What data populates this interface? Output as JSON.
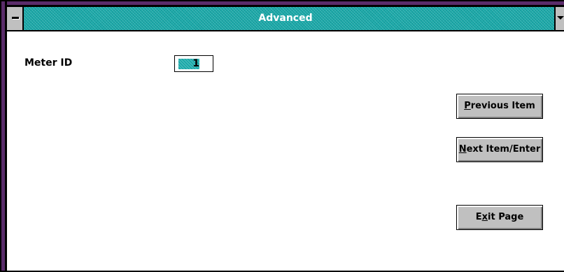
{
  "window": {
    "title": "Advanced"
  },
  "colors": {
    "titlebar": "#19a8a8",
    "frame": "#5a2c6a",
    "button_face": "#c0c0c0"
  },
  "form": {
    "meter_id_label": "Meter ID",
    "meter_id_value": "1"
  },
  "buttons": {
    "previous": {
      "mnemonic": "P",
      "rest": "revious Item"
    },
    "next": {
      "mnemonic": "N",
      "rest": "ext Item/Enter"
    },
    "exit": {
      "pre": "E",
      "mnemonic": "x",
      "rest": "it Page"
    }
  },
  "icons": {
    "system_menu": "system-menu-icon",
    "minimize": "minimize-arrow-icon"
  }
}
